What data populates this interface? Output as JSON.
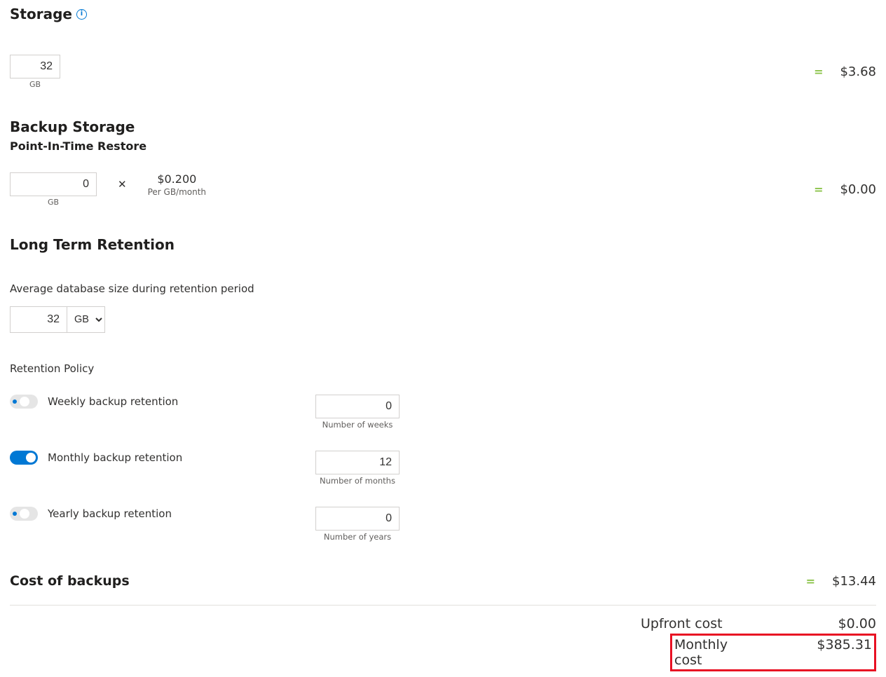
{
  "storage": {
    "heading": "Storage",
    "gb_value": "32",
    "gb_unit": "GB",
    "cost": "$3.68"
  },
  "backup": {
    "heading": "Backup Storage",
    "pitr_label": "Point-In-Time Restore",
    "gb_value": "0",
    "gb_unit": "GB",
    "rate_value": "$0.200",
    "rate_caption": "Per GB/month",
    "cost": "$0.00"
  },
  "ltr": {
    "heading": "Long Term Retention",
    "avg_label": "Average database size during retention period",
    "avg_value": "32",
    "avg_unit": "GB",
    "policy_label": "Retention Policy",
    "weekly": {
      "label": "Weekly backup retention",
      "value": "0",
      "caption": "Number of weeks"
    },
    "monthly": {
      "label": "Monthly backup retention",
      "value": "12",
      "caption": "Number of months"
    },
    "yearly": {
      "label": "Yearly backup retention",
      "value": "0",
      "caption": "Number of years"
    }
  },
  "cost_of_backups": {
    "label": "Cost of backups",
    "value": "$13.44"
  },
  "totals": {
    "upfront_label": "Upfront cost",
    "upfront_value": "$0.00",
    "monthly_label": "Monthly cost",
    "monthly_value": "$385.31"
  }
}
